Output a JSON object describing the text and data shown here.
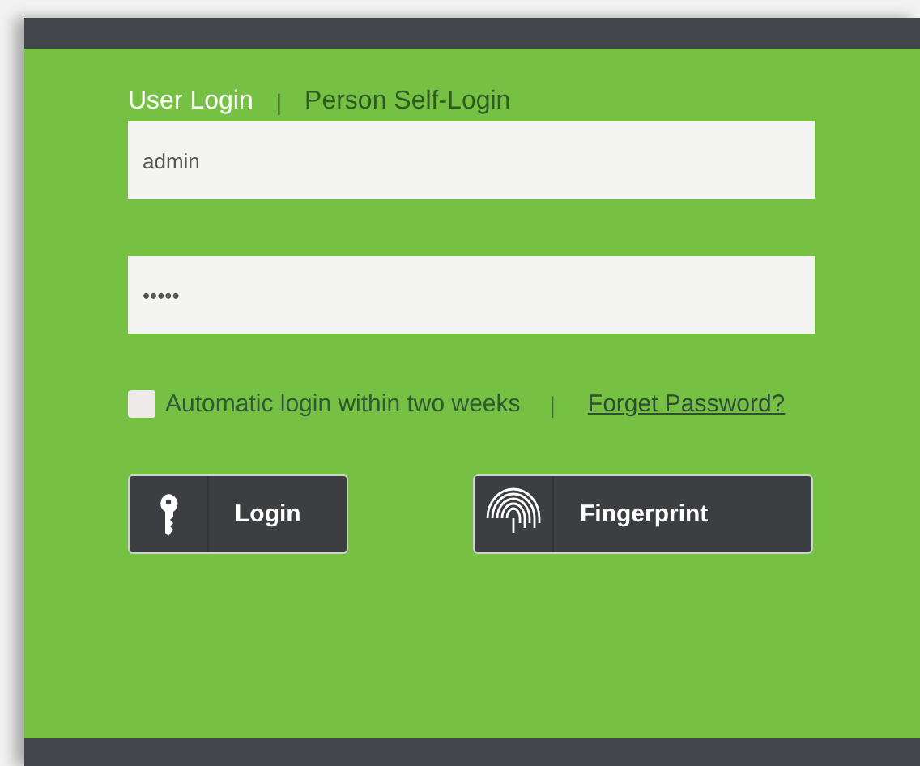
{
  "tabs": [
    {
      "label": "User Login",
      "selected": true
    },
    {
      "label": "Person Self-Login",
      "selected": false
    }
  ],
  "tab_separator": "|",
  "username": {
    "value": "admin"
  },
  "password": {
    "value": "•••••"
  },
  "remember": {
    "label": "Automatic login within two weeks",
    "checked": false
  },
  "link_separator": "|",
  "forgot_link": "Forget Password?",
  "buttons": [
    {
      "kind": "key",
      "label": "Login"
    },
    {
      "kind": "fingerprint",
      "label": "Fingerprint"
    }
  ]
}
